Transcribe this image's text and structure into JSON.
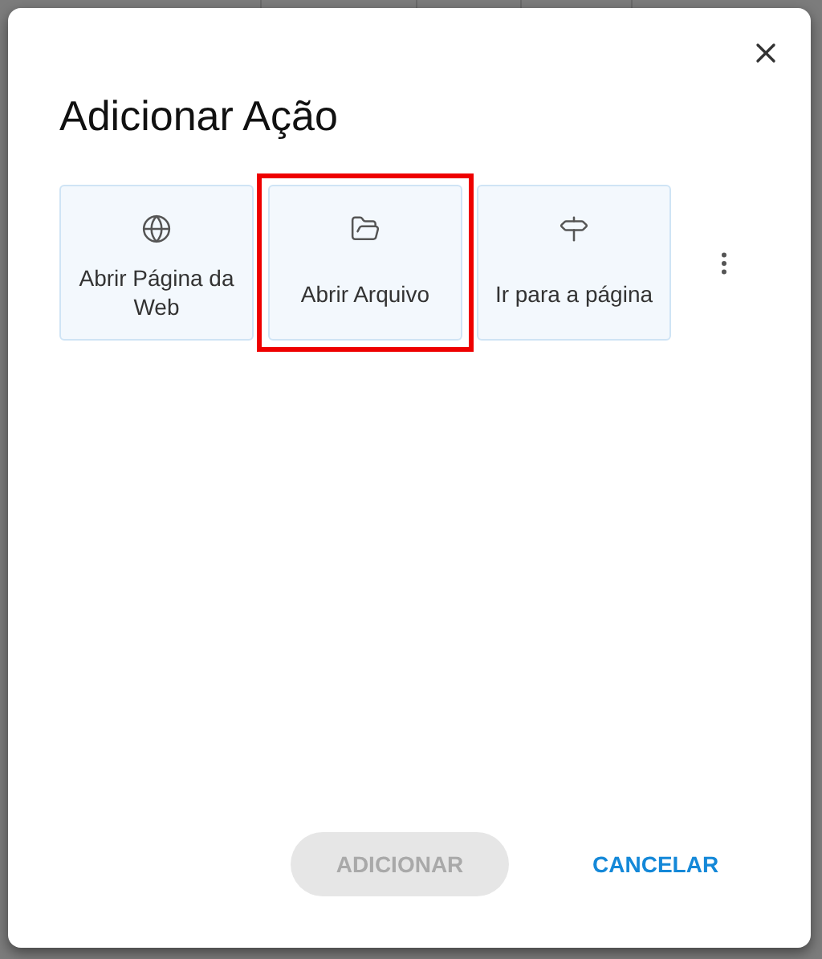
{
  "dialog": {
    "title": "Adicionar Ação",
    "actions": [
      {
        "label": "Abrir Página da Web",
        "selected": false
      },
      {
        "label": "Abrir Arquivo",
        "selected": true
      },
      {
        "label": "Ir para a página",
        "selected": false
      }
    ],
    "buttons": [
      {
        "label": "ADICIONAR",
        "kind": "primary",
        "disabled": true
      },
      {
        "label": "CANCELAR",
        "kind": "text",
        "disabled": false
      }
    ]
  }
}
